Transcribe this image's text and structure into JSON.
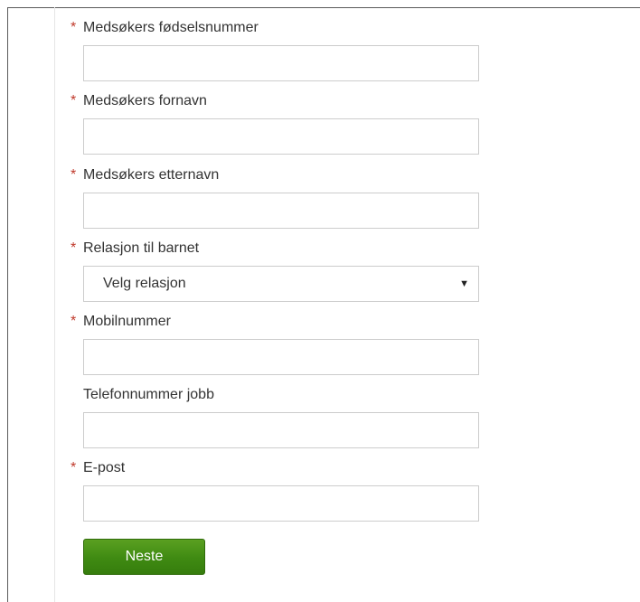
{
  "form": {
    "required_marker": "*",
    "fields": [
      {
        "label": "Medsøkers fødselsnummer",
        "required": true,
        "value": ""
      },
      {
        "label": "Medsøkers fornavn",
        "required": true,
        "value": ""
      },
      {
        "label": "Medsøkers etternavn",
        "required": true,
        "value": ""
      },
      {
        "label": "Relasjon til barnet",
        "required": true,
        "selected": "Velg relasjon"
      },
      {
        "label": "Mobilnummer",
        "required": true,
        "value": ""
      },
      {
        "label": "Telefonnummer jobb",
        "required": false,
        "value": ""
      },
      {
        "label": "E-post",
        "required": true,
        "value": ""
      }
    ],
    "submit_label": "Neste"
  },
  "icons": {
    "dropdown": "chevron-down-icon",
    "dropdown_glyph": "▼"
  },
  "colors": {
    "required_marker": "#c0392b",
    "button_green": "#3f8a12"
  }
}
